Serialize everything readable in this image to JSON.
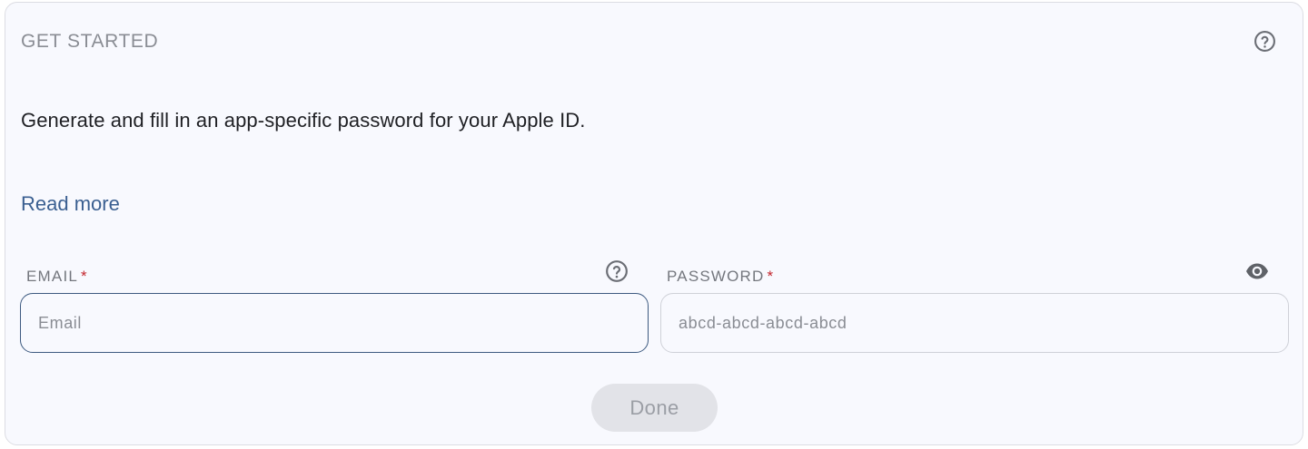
{
  "header": {
    "title": "GET STARTED",
    "help_icon": "help-circle-icon"
  },
  "description": "Generate and fill in an app-specific password for your Apple ID.",
  "read_more": "Read more",
  "fields": {
    "email": {
      "label": "EMAIL",
      "required_marker": "*",
      "placeholder": "Email",
      "value": "",
      "help_icon": "help-circle-icon"
    },
    "password": {
      "label": "PASSWORD",
      "required_marker": "*",
      "placeholder": "abcd-abcd-abcd-abcd",
      "value": "",
      "toggle_icon": "eye-icon"
    }
  },
  "done_button": {
    "label": "Done",
    "enabled": false
  },
  "colors": {
    "card_background": "#f8f9fe",
    "link": "#3a5f91",
    "focus_border": "#3d5a80",
    "required": "#c3242b",
    "button_disabled_bg": "#e2e3e8",
    "button_disabled_text": "#9b9ea5"
  }
}
